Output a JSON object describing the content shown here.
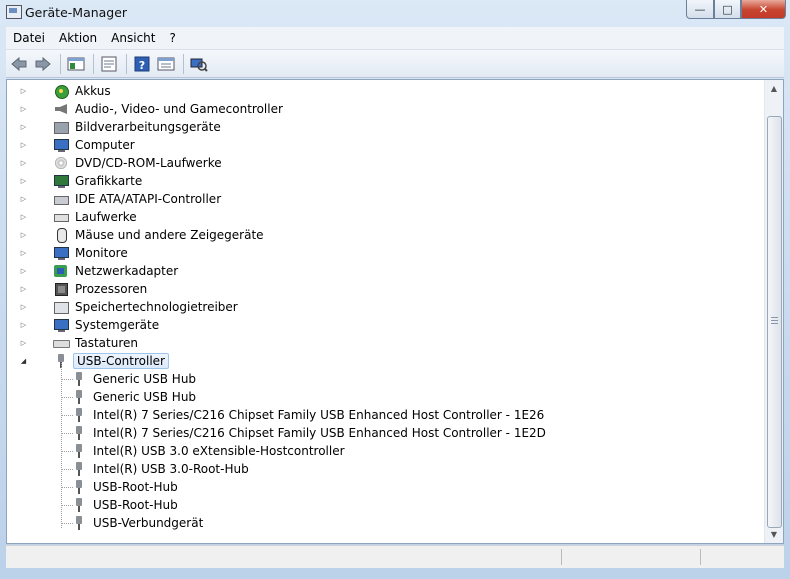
{
  "window": {
    "title": "Geräte-Manager",
    "buttons": {
      "minimize": "—",
      "maximize": "□",
      "close": "✕"
    }
  },
  "menu": {
    "items": [
      "Datei",
      "Aktion",
      "Ansicht",
      "?"
    ]
  },
  "toolbar": {
    "buttons": [
      "back-icon",
      "forward-icon",
      "show-hide-console-tree-icon",
      "properties-icon",
      "help-icon",
      "view-icon",
      "scan-hardware-icon"
    ]
  },
  "tree": {
    "categories": [
      {
        "label": "Akkus",
        "icon": "battery-icon"
      },
      {
        "label": "Audio-, Video- und Gamecontroller",
        "icon": "speaker-icon"
      },
      {
        "label": "Bildverarbeitungsgeräte",
        "icon": "camera-icon"
      },
      {
        "label": "Computer",
        "icon": "computer-icon"
      },
      {
        "label": "DVD/CD-ROM-Laufwerke",
        "icon": "dvd-icon"
      },
      {
        "label": "Grafikkarte",
        "icon": "display-adapter-icon"
      },
      {
        "label": "IDE ATA/ATAPI-Controller",
        "icon": "ide-controller-icon"
      },
      {
        "label": "Laufwerke",
        "icon": "disk-drive-icon"
      },
      {
        "label": "Mäuse und andere Zeigegeräte",
        "icon": "mouse-icon"
      },
      {
        "label": "Monitore",
        "icon": "monitor-icon"
      },
      {
        "label": "Netzwerkadapter",
        "icon": "network-adapter-icon"
      },
      {
        "label": "Prozessoren",
        "icon": "processor-icon"
      },
      {
        "label": "Speichertechnologietreiber",
        "icon": "storage-icon"
      },
      {
        "label": "Systemgeräte",
        "icon": "system-devices-icon"
      },
      {
        "label": "Tastaturen",
        "icon": "keyboard-icon"
      },
      {
        "label": "USB-Controller",
        "icon": "usb-icon",
        "expanded": true
      }
    ],
    "usb_children": [
      "Generic USB Hub",
      "Generic USB Hub",
      "Intel(R) 7 Series/C216 Chipset Family USB Enhanced Host Controller - 1E26",
      "Intel(R) 7 Series/C216 Chipset Family USB Enhanced Host Controller - 1E2D",
      "Intel(R) USB 3.0 eXtensible-Hostcontroller",
      "Intel(R) USB 3.0-Root-Hub",
      "USB-Root-Hub",
      "USB-Root-Hub",
      "USB-Verbundgerät"
    ]
  },
  "colors": {
    "selection": "#dbe9fa",
    "window_frame": "#c6d9ee",
    "close_button": "#c7442f"
  }
}
